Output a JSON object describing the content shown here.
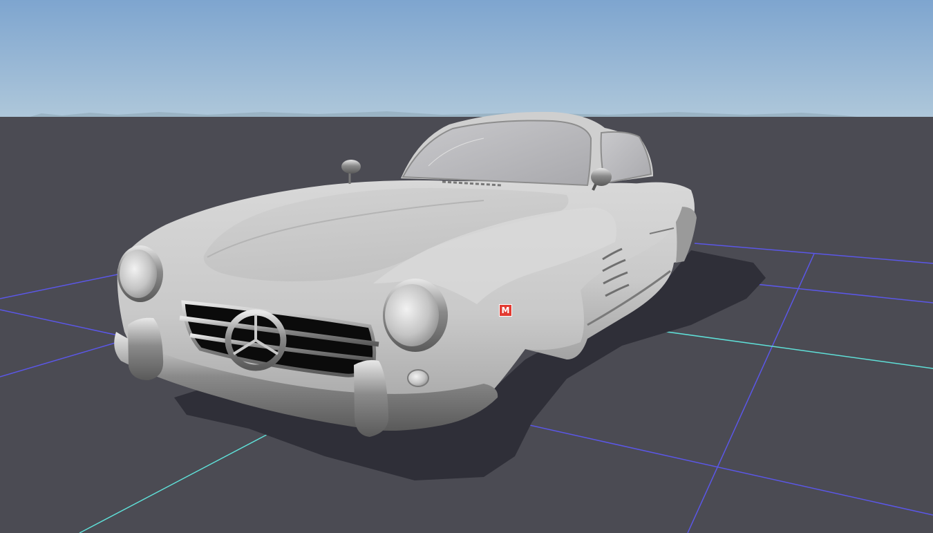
{
  "viewport": {
    "sky_top_color": "#7ea5cf",
    "sky_horizon_color": "#aec7da",
    "ground_color": "#4b4b53",
    "grid_line_color": "#5b57e8",
    "grid_axis_color": "#5fe0d8",
    "model_color": "#d5d5d5",
    "shadow_color": "#2f2f38"
  },
  "model": {
    "name": "car-body",
    "marker_label": "M",
    "marker_color": "#e23b32"
  }
}
